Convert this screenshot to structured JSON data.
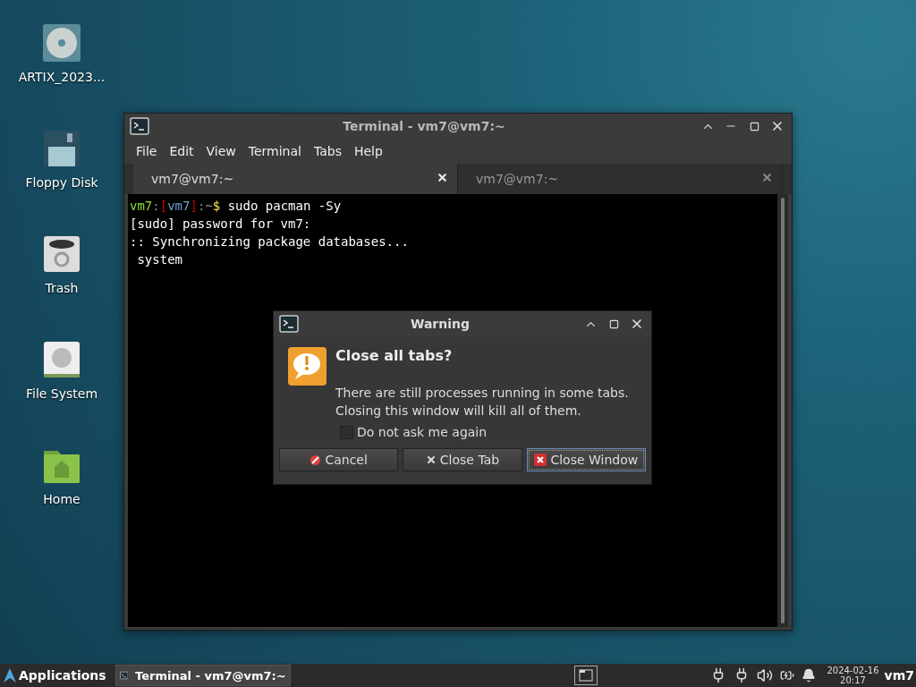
{
  "desktop_icons": [
    {
      "label": "ARTIX_2023...",
      "kind": "disc"
    },
    {
      "label": "Floppy Disk",
      "kind": "floppy"
    },
    {
      "label": "Trash",
      "kind": "trash"
    },
    {
      "label": "File System",
      "kind": "drive"
    },
    {
      "label": "Home",
      "kind": "home"
    }
  ],
  "terminal": {
    "title": "Terminal - vm7@vm7:~",
    "menu": [
      "File",
      "Edit",
      "View",
      "Terminal",
      "Tabs",
      "Help"
    ],
    "tabs": [
      {
        "label": "vm7@vm7:~",
        "selected": true
      },
      {
        "label": "vm7@vm7:~",
        "selected": false
      }
    ],
    "lines": [
      {
        "segments": [
          {
            "text": "vm7",
            "color": "#8ae234"
          },
          {
            "text": ":",
            "color": "#888a85"
          },
          {
            "text": "[",
            "color": "#cc0000"
          },
          {
            "text": "vm7",
            "color": "#729fcf"
          },
          {
            "text": "]",
            "color": "#cc0000"
          },
          {
            "text": ":~",
            "color": "#888a85"
          },
          {
            "text": "$",
            "color": "#fce94f"
          },
          {
            "text": " sudo pacman -Sy",
            "color": "#ffffff"
          }
        ]
      },
      {
        "segments": [
          {
            "text": "[sudo] password for vm7:",
            "color": "#ffffff"
          }
        ]
      },
      {
        "segments": [
          {
            "text": ":: Synchronizing package databases...",
            "color": "#ffffff"
          }
        ]
      },
      {
        "segments": [
          {
            "text": " system",
            "color": "#ffffff"
          }
        ]
      }
    ]
  },
  "dialog": {
    "title": "Warning",
    "heading": "Close all tabs?",
    "message": [
      "There are still processes running in some tabs.",
      "Closing this window will kill all of them."
    ],
    "checkbox": {
      "label": "Do not ask me again",
      "checked": false
    },
    "buttons": [
      {
        "label": "Cancel",
        "kind": "cancel",
        "focused": false
      },
      {
        "label": "Close Tab",
        "kind": "close-tab",
        "focused": false
      },
      {
        "label": "Close Window",
        "kind": "close-window",
        "focused": true
      }
    ]
  },
  "taskbar": {
    "menu_label": "Applications",
    "tasks": [
      {
        "label": "Terminal - vm7@vm7:~",
        "selected": true
      }
    ],
    "date": "2024-02-16",
    "time": "20:17",
    "user": "vm7"
  }
}
